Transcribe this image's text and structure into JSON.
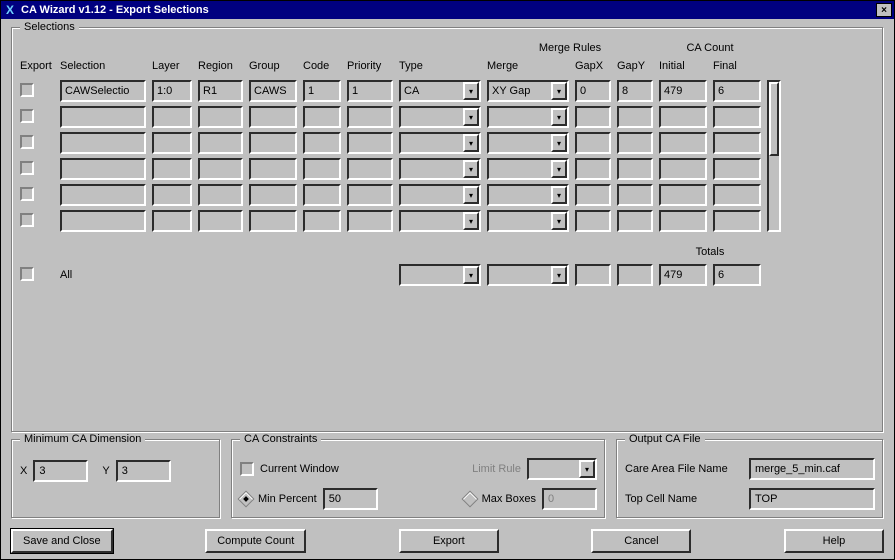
{
  "window": {
    "title": "CA Wizard v1.12 - Export Selections"
  },
  "selections_box": {
    "legend": "Selections",
    "super_headers": {
      "merge_rules": "Merge Rules",
      "ca_count": "CA Count"
    },
    "headers": {
      "export": "Export",
      "selection": "Selection",
      "layer": "Layer",
      "region": "Region",
      "group": "Group",
      "code": "Code",
      "priority": "Priority",
      "type": "Type",
      "merge": "Merge",
      "gapx": "GapX",
      "gapy": "GapY",
      "initial": "Initial",
      "final": "Final"
    },
    "rows": [
      {
        "export": false,
        "selection": "CAWSelectio",
        "layer": "1:0",
        "region": "R1",
        "group": "CAWS",
        "code": "1",
        "priority": "1",
        "type": "CA",
        "merge": "XY Gap",
        "gapx": "0",
        "gapy": "8",
        "initial": "479",
        "final": "6"
      },
      {
        "export": false
      },
      {
        "export": false
      },
      {
        "export": false
      },
      {
        "export": false
      },
      {
        "export": false
      }
    ],
    "totals_label": "Totals",
    "all_row": {
      "export": false,
      "label": "All",
      "type": "",
      "merge": "",
      "gapx": "",
      "gapy": "",
      "initial": "479",
      "final": "6"
    }
  },
  "min_ca": {
    "legend": "Minimum CA Dimension",
    "x_label": "X",
    "x": "3",
    "y_label": "Y",
    "y": "3"
  },
  "constraints": {
    "legend": "CA Constraints",
    "current_window": "Current Window",
    "limit_rule_label": "Limit Rule",
    "limit_rule": "",
    "min_percent_label": "Min Percent",
    "min_percent": "50",
    "max_boxes_label": "Max Boxes",
    "max_boxes": "0"
  },
  "output": {
    "legend": "Output CA File",
    "file_label": "Care Area File Name",
    "file": "merge_5_min.caf",
    "top_label": "Top Cell Name",
    "top": "TOP"
  },
  "buttons": {
    "save": "Save and Close",
    "compute": "Compute Count",
    "export": "Export",
    "cancel": "Cancel",
    "help": "Help"
  }
}
